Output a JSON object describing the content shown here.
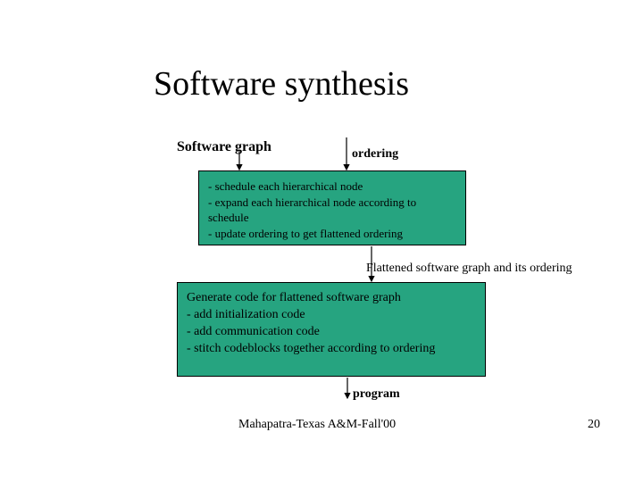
{
  "title": "Software synthesis",
  "labels": {
    "software_graph": "Software graph",
    "ordering": "ordering",
    "flattened": "Flattened software graph and its ordering",
    "program": "program"
  },
  "box1": {
    "line1": "- schedule each hierarchical node",
    "line2": "- expand each hierarchical node according to",
    "line3": "  schedule",
    "line4": "- update ordering to get flattened ordering"
  },
  "box2": {
    "line1": "Generate code for flattened software graph",
    "line2": "- add initialization code",
    "line3": "- add communication code",
    "line4": "- stitch codeblocks together according to ordering"
  },
  "footer": {
    "text": "Mahapatra-Texas A&M-Fall'00",
    "page": "20"
  }
}
